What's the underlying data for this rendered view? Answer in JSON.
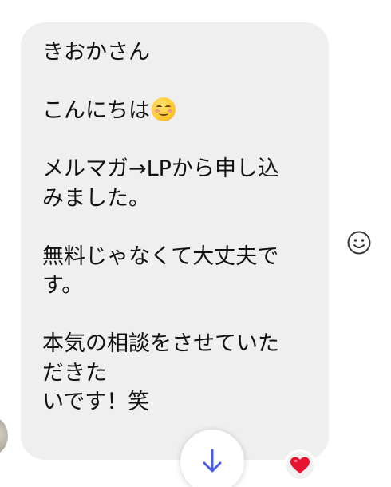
{
  "message": {
    "lines": [
      "きおかさん",
      "",
      "こんにちは",
      "",
      "メルマガ→LPから申し込",
      "みました。",
      "",
      "無料じゃなくて大丈夫で",
      "す。",
      "",
      "本気の相談をさせていた",
      "だきた",
      "いです！笑"
    ],
    "greeting_emoji": "smiling-face-with-blush-emoji",
    "bubble_color": "#efefef"
  },
  "reactions": {
    "add_reaction_icon": "smiley-outline-icon",
    "existing": "heart",
    "existing_color": "#e8142f"
  },
  "controls": {
    "scroll_down_icon": "arrow-down-icon",
    "accent": "#4a5ae8"
  }
}
